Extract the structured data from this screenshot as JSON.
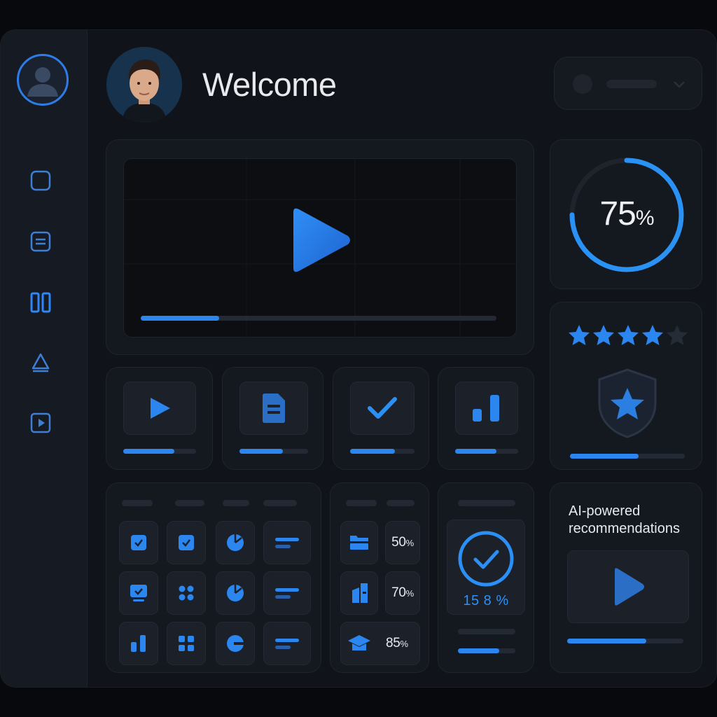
{
  "header": {
    "welcome_text": "Welcome",
    "dropdown_icon": "chevron-down-icon"
  },
  "sidebar": {
    "items": [
      {
        "icon": "user-avatar-icon",
        "active": true
      },
      {
        "icon": "square-icon"
      },
      {
        "icon": "document-icon"
      },
      {
        "icon": "columns-icon"
      },
      {
        "icon": "triangle-icon"
      },
      {
        "icon": "play-icon"
      }
    ]
  },
  "video_player": {
    "progress": 0.22,
    "icon": "play-icon"
  },
  "progress_ring": {
    "value": "75",
    "unit": "%",
    "fraction": 0.75
  },
  "rating_card": {
    "stars_filled": 4,
    "stars_total": 5,
    "badge_icon": "shield-star-icon",
    "progress": 0.6
  },
  "quick_tiles": [
    {
      "icon": "play-icon",
      "progress": 0.7
    },
    {
      "icon": "document-icon",
      "progress": 0.63
    },
    {
      "icon": "check-icon",
      "progress": 0.7
    },
    {
      "icon": "bar-chart-icon",
      "progress": 0.65
    }
  ],
  "grid_panel": {
    "icons": [
      "checkbox-icon",
      "checkbox-icon",
      "pie-chart-icon",
      "lines-icon",
      "monitor-check-icon",
      "dots-icon",
      "pie-chart-icon",
      "lines-icon",
      "bar-chart-icon",
      "grid-icon",
      "toggle-icon",
      "lines-icon"
    ]
  },
  "stats_panel": {
    "rows": [
      {
        "icon": "card-icon",
        "value": "50",
        "unit": "%"
      },
      {
        "icon": "book-icon",
        "value": "70",
        "unit": "%"
      },
      {
        "icon": "graduation-cap-icon",
        "value": "85",
        "unit": "%"
      }
    ]
  },
  "check_panel": {
    "value_text": "15 8 %",
    "icon": "check-circle-icon",
    "progress": 0.72
  },
  "recommendation": {
    "title": "AI-powered recommendations",
    "icon": "play-icon",
    "progress": 0.68
  },
  "colors": {
    "accent": "#2c86f0",
    "background": "#101319",
    "card": "#14181f",
    "tile": "#1b2029"
  }
}
